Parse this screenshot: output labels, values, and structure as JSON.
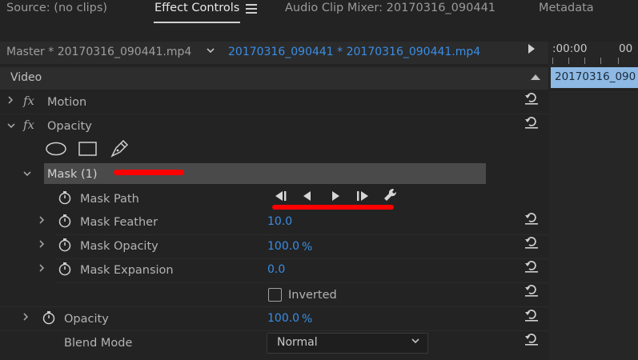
{
  "tabs": [
    {
      "label": "Source: (no clips)"
    },
    {
      "label": "Effect Controls"
    },
    {
      "label": "Audio Clip Mixer: 20170316_090441"
    },
    {
      "label": "Metadata"
    }
  ],
  "clip_header": {
    "master": "Master * 20170316_090441.mp4",
    "sequence_clip": "20170316_090441 * 20170316_090441.mp4"
  },
  "timeline": {
    "time_start": ":00:00",
    "time_next": "00",
    "clip_label": "20170316_090"
  },
  "section": {
    "label": "Video"
  },
  "effects": {
    "motion": {
      "fx": "fx",
      "label": "Motion"
    },
    "opacity": {
      "fx": "fx",
      "label": "Opacity"
    }
  },
  "mask": {
    "label": "Mask (1)",
    "path_label": "Mask Path",
    "feather_label": "Mask Feather",
    "feather_value": "10.0",
    "opacity_label": "Mask Opacity",
    "opacity_value": "100.0",
    "opacity_unit": "%",
    "expansion_label": "Mask Expansion",
    "expansion_value": "0.0",
    "inverted_label": "Inverted"
  },
  "opacity_prop": {
    "label": "Opacity",
    "value": "100.0",
    "unit": "%"
  },
  "blend": {
    "label": "Blend Mode",
    "value": "Normal"
  },
  "colors": {
    "accent": "#3a8ee6",
    "annotation": "#ff0000",
    "clip": "#8db9e4"
  }
}
